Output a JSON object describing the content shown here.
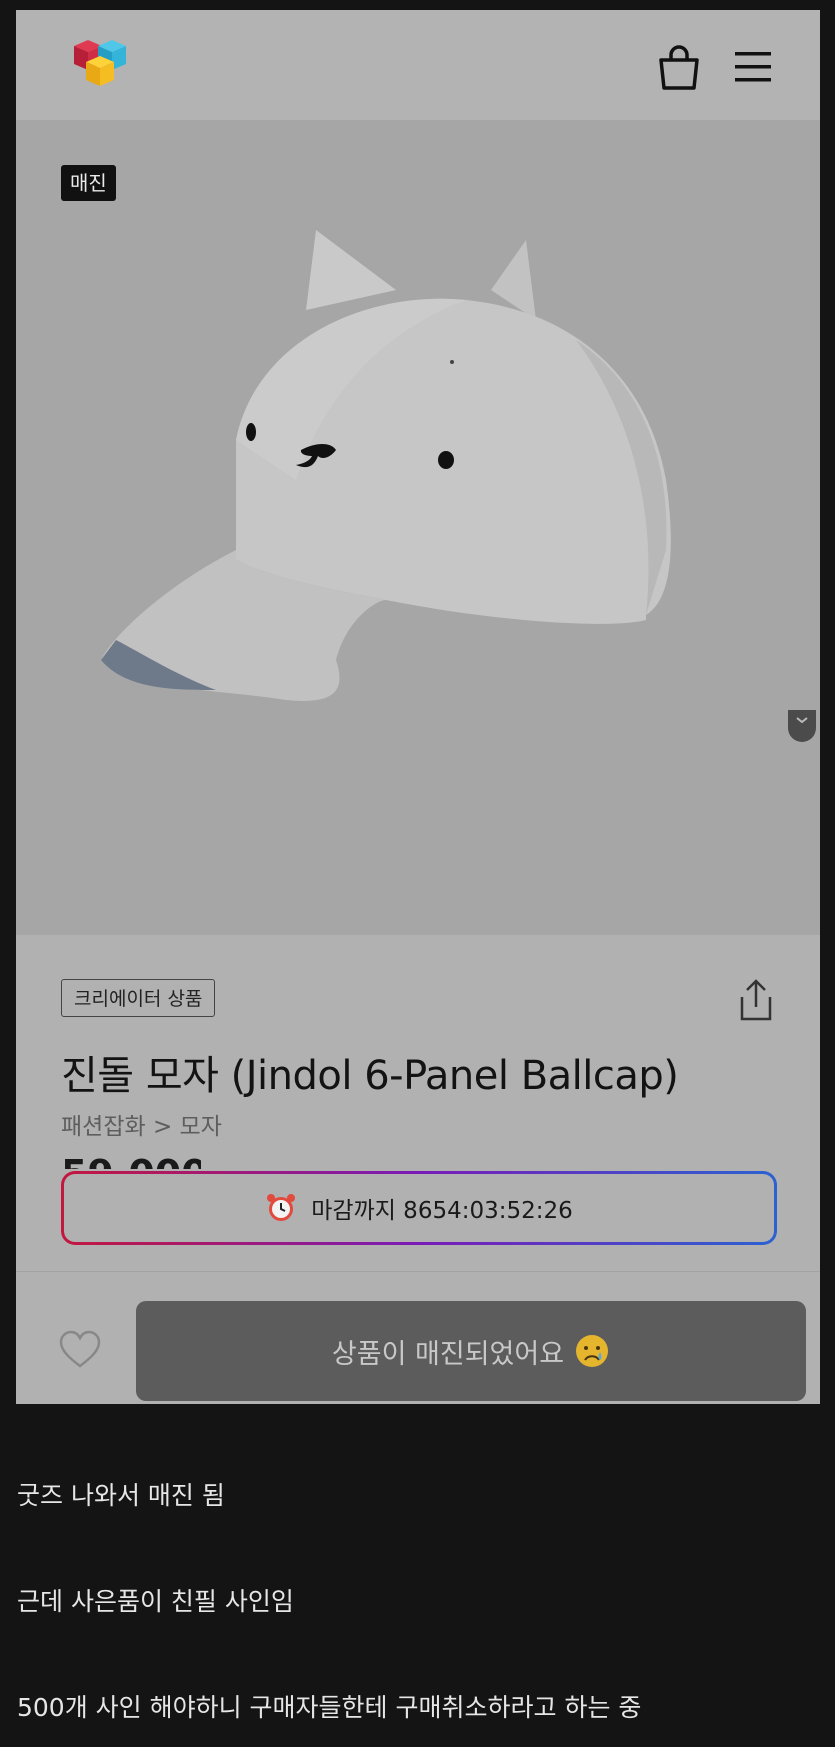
{
  "header": {
    "logo_icon": "colorful-cubes-logo",
    "bag_icon": "shopping-bag-icon",
    "menu_icon": "hamburger-menu-icon"
  },
  "hero": {
    "soldout_tag": "매진",
    "image_alt": "white cap with dog ears and face"
  },
  "product": {
    "creator_badge": "크리에이터 상품",
    "title": "진돌 모자 (Jindol 6-Panel Ballcap)",
    "breadcrumb": "패션잡화 > 모자",
    "price_peek": "59,000",
    "deadline_text": "마감까지 8654:03:52:26",
    "soldout_button": "상품이 매진되었어요"
  },
  "colors": {
    "gradient_start": "#c2183f",
    "gradient_mid": "#7a1bb7",
    "gradient_end": "#2b62d2",
    "button_bg": "#5c5c5c"
  },
  "captions": [
    "굿즈 나와서 매진 됨",
    "근데 사은품이 친필 사인임",
    "500개 사인 해야하니 구매자들한테 구매취소하라고 하는 중"
  ]
}
